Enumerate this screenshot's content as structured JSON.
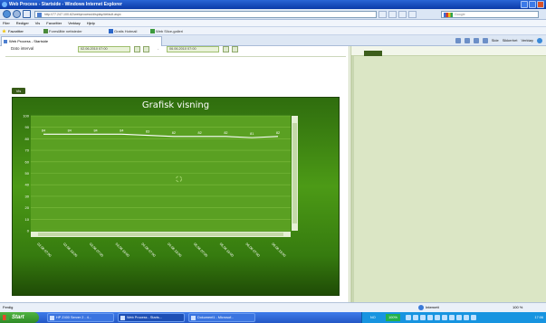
{
  "window": {
    "title": "Web Process - Startside - Windows Internet Explorer"
  },
  "address": {
    "url": "http://77.247.100.62/webprocess/display/default.aspx",
    "search_placeholder": "Google"
  },
  "menu": {
    "items": [
      "Filer",
      "Rediger",
      "Vis",
      "Favoritter",
      "Verktøy",
      "Hjelp"
    ]
  },
  "favorites": {
    "label": "Favoritter",
    "links": [
      "Foreslåtte nettsteder",
      "Gratis Hotmail",
      "Web Slice-galleri"
    ]
  },
  "tab": {
    "label": "Web Process - Startside"
  },
  "commandbar": {
    "items": [
      "Side",
      "Sikkerhet",
      "Verktøy"
    ]
  },
  "form": {
    "date_interval_label": "Dato interval",
    "date_from": "02.06.2010 07:00",
    "date_to": "06.06.2010 07:00",
    "date_separator": "-",
    "show_button": "Vis"
  },
  "chart_data": {
    "type": "line",
    "title": "Grafisk visning",
    "ylim": [
      0,
      100
    ],
    "y_ticks": [
      0,
      10,
      20,
      30,
      40,
      50,
      60,
      70,
      80,
      90,
      100
    ],
    "categories": [
      "02.06 07:00",
      "02.06 19:00",
      "03.06 07:00",
      "03.06 19:00",
      "04.06 07:00",
      "04.06 19:00",
      "05.06 07:00",
      "05.06 19:00",
      "06.06 07:00",
      "06.06 19:00"
    ],
    "series": [
      {
        "values": [
          84,
          84,
          84,
          84,
          83,
          82,
          82,
          82,
          81,
          82
        ],
        "color": "#ffffff"
      }
    ],
    "grid": true,
    "plot_color": "#5aa022"
  },
  "statusbar": {
    "left_text": "Ferdig",
    "zone": "Internett",
    "zoom": "100 %"
  },
  "taskbar": {
    "start_label": "Start",
    "items": [
      "HP Z400 Server 2 - 4...",
      "Web Process - Starts...",
      "Dokument1 - Microsof..."
    ],
    "language": "NO",
    "volume": "100%",
    "clock": "17:06"
  }
}
